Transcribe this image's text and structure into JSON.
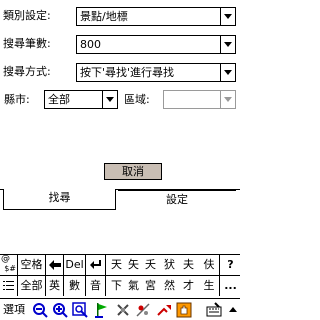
{
  "form": {
    "category_label": "類別設定:",
    "category_value": "景點/地標",
    "count_label": "搜尋筆數:",
    "count_value": "800",
    "mode_label": "搜尋方式:",
    "mode_value": "按下'尋找'進行尋找",
    "county_label": "縣市:",
    "county_value": "全部",
    "area_label": "區域:",
    "area_value": ""
  },
  "buttons": {
    "cancel": "取消"
  },
  "tabs": {
    "search": "找尋",
    "settings": "設定"
  },
  "keyboard": {
    "row1": [
      "空格",
      "Del",
      "天",
      "矢",
      "夭",
      "犾",
      "夫",
      "伕",
      "?"
    ],
    "row2": [
      "全部",
      "英",
      "數",
      "音",
      "下",
      "氣",
      "宮",
      "然",
      "才",
      "生"
    ],
    "sym_top": "@",
    "sym_bottom": "$#",
    "more": "..."
  },
  "taskbar": {
    "options": "選項"
  },
  "colors": {
    "cancel_bg": "#c9beb4",
    "border": "#000000",
    "disabled": "#9a9a9a"
  }
}
